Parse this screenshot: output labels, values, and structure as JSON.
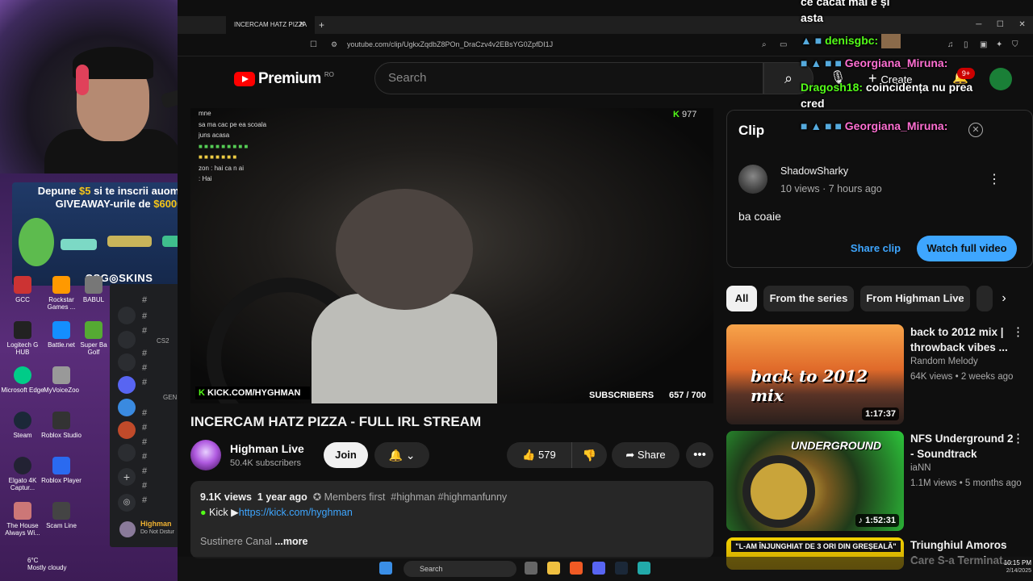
{
  "browser": {
    "tab_title": "INCERCAM HATZ PIZZA",
    "tab_close": "✕",
    "new_tab": "+",
    "url": "youtube.com/clip/UgkxZqdbZ8POn_DraCzv4v2EBsYG0ZpfDI1J",
    "window_controls": [
      "─",
      "☐",
      "✕"
    ]
  },
  "youtube": {
    "logo_text": "Premium",
    "country": "RO",
    "search_placeholder": "Search",
    "create_label": "Create",
    "notifications_badge": "9+"
  },
  "video": {
    "viewer_count": "977",
    "kick_url": "KICK.COM/HYGHMAN",
    "subscribers_label": "SUBSCRIBERS",
    "subscribers_count": "657 / 700",
    "chat_lines": [
      "mne",
      "sa ma cac pe ea scoala",
      "juns acasa",
      "",
      "zon : hai ca n ai",
      "nicoleta124 :",
      ": Hai"
    ],
    "title": "INCERCAM HATZ PIZZA - FULL IRL STREAM"
  },
  "channel": {
    "name": "Highman Live",
    "subscribers": "50.4K subscribers",
    "join_label": "Join"
  },
  "actions": {
    "like_count": "579",
    "share_label": "Share"
  },
  "description": {
    "views": "9.1K views",
    "age": "1 year ago",
    "members": "Members first",
    "hashtags": "#highman #highmanfunny",
    "kick_label": "Kick ▶",
    "kick_link": "https://kick.com/hyghman",
    "preview": "Sustinere Canal",
    "more_label": "...more"
  },
  "clip": {
    "heading": "Clip",
    "author": "ShadowSharky",
    "stats": "10 views · 7 hours ago",
    "text": "ba coaie",
    "share_clip_label": "Share clip",
    "watch_full_label": "Watch full video"
  },
  "chips": [
    "All",
    "From the series",
    "From Highman Live"
  ],
  "recommendations": [
    {
      "title": "back to 2012 mix | throwback vibes ...",
      "channel": "Random Melody",
      "stats": "64K views • 2 weeks ago",
      "duration": "1:17:37",
      "thumb_text": "back to 2012 mix"
    },
    {
      "title": "NFS Underground 2 - Soundtrack",
      "channel": "iaNN",
      "stats": "1.1M views • 5 months ago",
      "duration": "♪ 1:52:31",
      "thumb_text": "UNDERGROUND"
    },
    {
      "title": "Triunghiul Amoros Care S-a Terminat...",
      "channel": "",
      "stats": "",
      "duration": "",
      "thumb_text": "\"L-AM ÎNJUNGHIAT DE 3 ORI DIN GREȘEALĂ\""
    }
  ],
  "stream_overlay": {
    "chat": [
      {
        "user": "",
        "text": "ce cacat mai e și"
      },
      {
        "user": "",
        "text": "asta"
      },
      {
        "user": "denisgbc:",
        "text": ""
      },
      {
        "user": "Georgiana_Miruna:",
        "text": ""
      },
      {
        "user": "Dragosh18:",
        "text": "coincidența nu prea"
      },
      {
        "user": "",
        "text": "cred"
      },
      {
        "user": "Georgiana_Miruna:",
        "text": ""
      }
    ],
    "sponsor_line1_a": "Depune ",
    "sponsor_amount1": "$5",
    "sponsor_line1_b": " si te inscrii auomat la",
    "sponsor_line2_a": "GIVEAWAY-urile de ",
    "sponsor_amount2": "$6000",
    "sponsor_brand": "CSG◎SKINS"
  },
  "desktop_icons": [
    {
      "label": "GCC",
      "color": "#c33"
    },
    {
      "label": "Rockstar Games ...",
      "color": "#f90"
    },
    {
      "label": "BABUL",
      "color": "#777"
    },
    {
      "label": "Logitech G HUB",
      "color": "#222"
    },
    {
      "label": "Battle.net",
      "color": "#148eff"
    },
    {
      "label": "Super Ba Golf",
      "color": "#5a3"
    },
    {
      "label": "Microsoft Edge",
      "color": "#0c8"
    },
    {
      "label": "MyVoiceZoo",
      "color": "#999"
    },
    {
      "label": "Steam",
      "color": "#1b2838"
    },
    {
      "label": "Roblox Studio",
      "color": "#333"
    },
    {
      "label": "Elgato 4K Captur...",
      "color": "#223"
    },
    {
      "label": "Roblox Player",
      "color": "#2a6af0"
    },
    {
      "label": "The House Always Wi...",
      "color": "#c77"
    },
    {
      "label": "Scam Line",
      "color": "#444"
    }
  ],
  "chat_app": {
    "channel_label": "CS2",
    "gen_label": "GEN",
    "user_name": "Highman",
    "user_status": "Do Not Distur"
  },
  "weather": {
    "temp": "6°C",
    "condition": "Mostly cloudy"
  },
  "taskbar": {
    "search": "Search",
    "time": "10:15 PM",
    "date": "2/14/2025"
  }
}
